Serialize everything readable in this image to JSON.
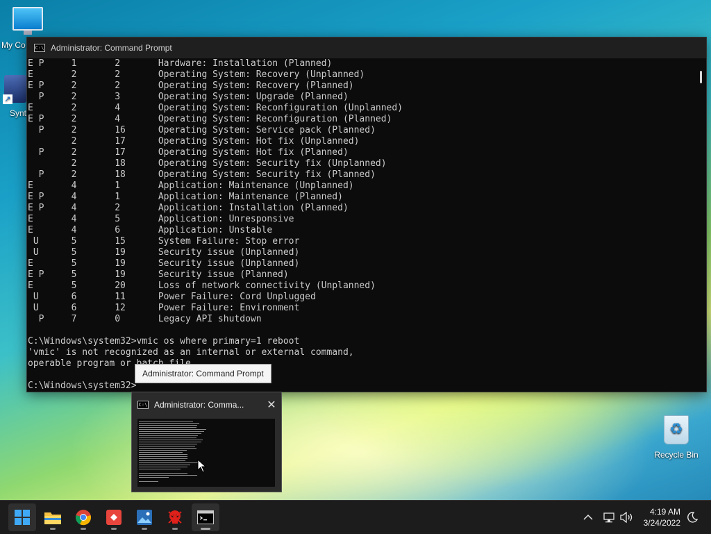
{
  "desktop": {
    "icons": [
      {
        "label": "My Co"
      },
      {
        "label": "Synt"
      },
      {
        "label": "Recycle Bin"
      }
    ]
  },
  "cmd_window": {
    "title": "Administrator: Command Prompt",
    "lines": [
      "E P     1       2       Hardware: Installation (Planned)",
      "E       2       2       Operating System: Recovery (Unplanned)",
      "E P     2       2       Operating System: Recovery (Planned)",
      "  P     2       3       Operating System: Upgrade (Planned)",
      "E       2       4       Operating System: Reconfiguration (Unplanned)",
      "E P     2       4       Operating System: Reconfiguration (Planned)",
      "  P     2       16      Operating System: Service pack (Planned)",
      "        2       17      Operating System: Hot fix (Unplanned)",
      "  P     2       17      Operating System: Hot fix (Planned)",
      "        2       18      Operating System: Security fix (Unplanned)",
      "  P     2       18      Operating System: Security fix (Planned)",
      "E       4       1       Application: Maintenance (Unplanned)",
      "E P     4       1       Application: Maintenance (Planned)",
      "E P     4       2       Application: Installation (Planned)",
      "E       4       5       Application: Unresponsive",
      "E       4       6       Application: Unstable",
      " U      5       15      System Failure: Stop error",
      " U      5       19      Security issue (Unplanned)",
      "E       5       19      Security issue (Unplanned)",
      "E P     5       19      Security issue (Planned)",
      "E       5       20      Loss of network connectivity (Unplanned)",
      " U      6       11      Power Failure: Cord Unplugged",
      " U      6       12      Power Failure: Environment",
      "  P     7       0       Legacy API shutdown",
      "",
      "C:\\Windows\\system32>vmic os where primary=1 reboot",
      "'vmic' is not recognized as an internal or external command,",
      "operable program or batch file.",
      "",
      "C:\\Windows\\system32>"
    ]
  },
  "tooltip": {
    "text": "Administrator: Command Prompt"
  },
  "preview": {
    "title": "Administrator: Comma..."
  },
  "taskbar": {
    "apps": [
      {
        "name": "start-icon"
      },
      {
        "name": "file-explorer-icon"
      },
      {
        "name": "chrome-icon"
      },
      {
        "name": "app-red-icon"
      },
      {
        "name": "photos-icon"
      },
      {
        "name": "skull-app-icon"
      },
      {
        "name": "command-prompt-icon"
      }
    ],
    "clock_time": "4:19 AM",
    "clock_date": "3/24/2022"
  }
}
